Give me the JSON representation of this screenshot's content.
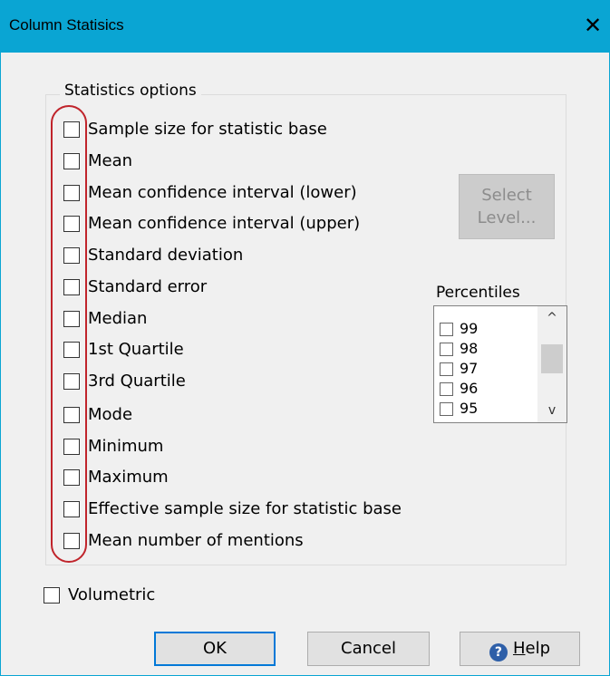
{
  "window": {
    "title": "Column Statisics",
    "close_glyph": "✕"
  },
  "group_title": "Statistics options",
  "options": [
    "Sample size for statistic base",
    "Mean",
    "Mean confidence interval (lower)",
    "Mean confidence interval (upper)",
    "Standard deviation",
    "Standard error",
    "Median",
    "1st Quartile",
    "3rd Quartile",
    "Mode",
    "Minimum",
    "Maximum",
    "Effective sample size for statistic base",
    "Mean number of mentions"
  ],
  "select_level": {
    "line1": "Select",
    "line2": "Level..."
  },
  "percentiles": {
    "title": "Percentiles",
    "items": [
      "99",
      "98",
      "97",
      "96",
      "95"
    ],
    "scroll_up": "^",
    "scroll_down": "v"
  },
  "volumetric_label": "Volumetric",
  "buttons": {
    "ok": "OK",
    "cancel": "Cancel",
    "help_first": "H",
    "help_rest": "elp",
    "help_icon": "?"
  },
  "colors": {
    "titlebar": "#0aa5d3",
    "highlight_oval": "#c0242b",
    "default_button_border": "#0078d7"
  }
}
